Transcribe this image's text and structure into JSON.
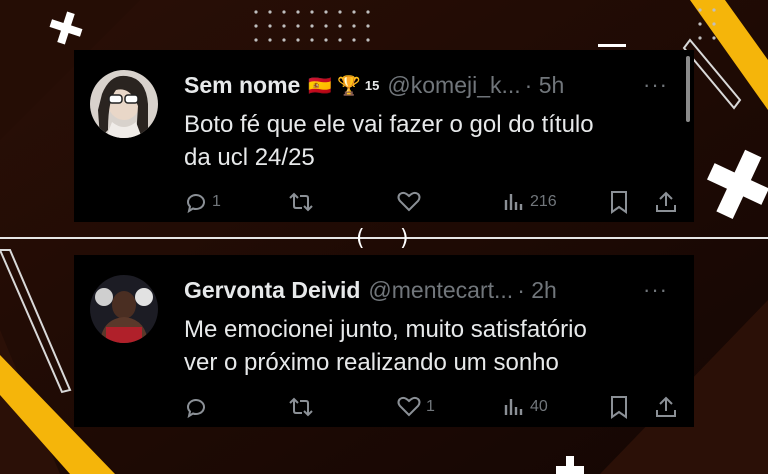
{
  "tweets": [
    {
      "name": "Sem nome",
      "badges": "🇪🇸 🏆",
      "badge_count": "15",
      "handle": "@komeji_k...",
      "time": "· 5h",
      "text_line1": "Boto fé que ele vai fazer o gol do título",
      "text_line2": "da ucl 24/25",
      "replies": "1",
      "retweets": "",
      "likes": "",
      "views": "216"
    },
    {
      "name": "Gervonta Deivid",
      "handle": "@mentecart...",
      "time": "· 2h",
      "text_line1": "Me emocionei junto, muito satisfatório",
      "text_line2": "ver o próximo realizando um sonho",
      "replies": "",
      "retweets": "",
      "likes": "1",
      "views": "40"
    }
  ],
  "more_label": "···",
  "divider_center": "(  )",
  "colors": {
    "card_bg": "#000000",
    "text": "#e7e9ea",
    "muted": "#71767b",
    "accent_yellow": "#f5b50a",
    "bg_brown": "#1a0b05"
  }
}
